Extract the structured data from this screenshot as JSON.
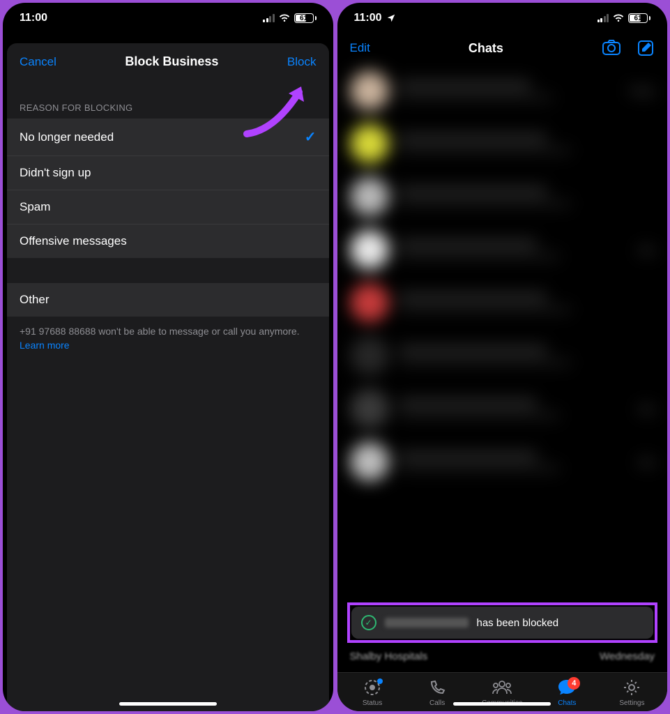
{
  "left": {
    "status": {
      "time": "11:00",
      "battery": "61"
    },
    "sheet": {
      "cancel": "Cancel",
      "title": "Block Business",
      "block": "Block",
      "section_header": "REASON FOR BLOCKING",
      "options": [
        "No longer needed",
        "Didn't sign up",
        "Spam",
        "Offensive messages"
      ],
      "selected_index": 0,
      "other_label": "Other",
      "footer_prefix": "+91 97688 88688 won't be able to message or call you anymore. ",
      "footer_link": "Learn more"
    }
  },
  "right": {
    "status": {
      "time": "11:00",
      "battery": "61"
    },
    "nav": {
      "edit": "Edit",
      "title": "Chats"
    },
    "toast": {
      "suffix": "has been blocked"
    },
    "peek": {
      "name": "Shalby Hospitals",
      "time": "Wednesday"
    },
    "tabs": {
      "status": "Status",
      "calls": "Calls",
      "communities": "Communities",
      "chats": "Chats",
      "settings": "Settings",
      "badge": "4"
    },
    "chat_times": [
      "Today",
      "",
      "",
      "day",
      "",
      "",
      "day",
      "day"
    ]
  },
  "avatar_colors": [
    "#c9b29c",
    "#d8d838",
    "#b8b8b8",
    "#e8e8e8",
    "#c43a3a",
    "#262626",
    "#3a3a3a",
    "#bdbdbd"
  ]
}
